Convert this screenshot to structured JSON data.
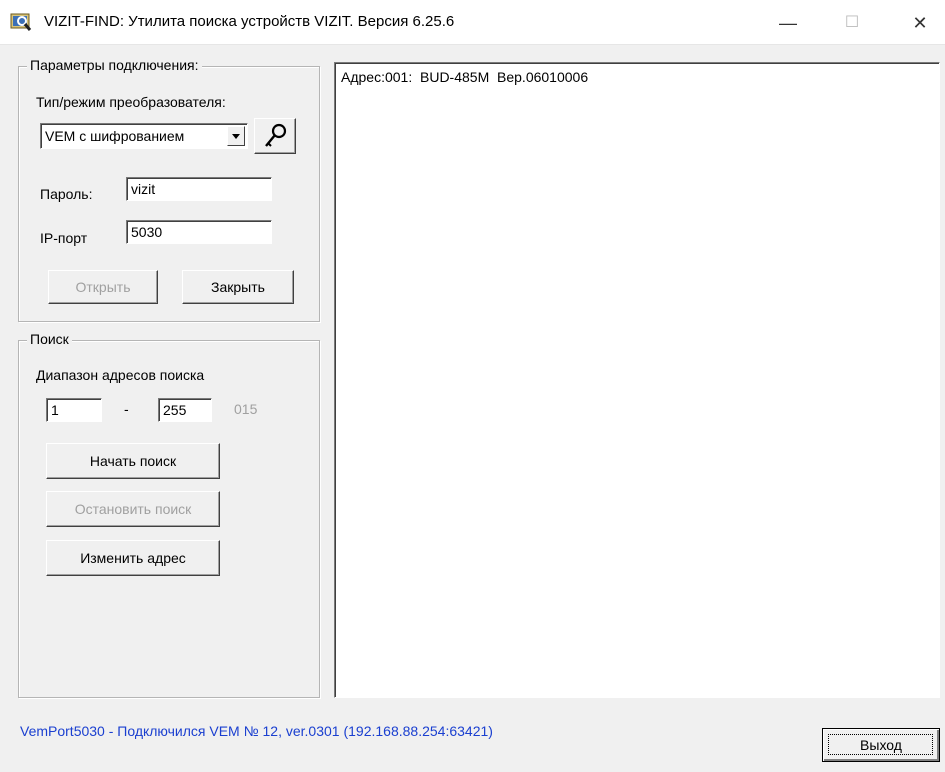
{
  "window": {
    "title": "VIZIT-FIND: Утилита поиска устройств VIZIT. Версия 6.25.6",
    "minimize": "—",
    "maximize": "☐",
    "close": "✕"
  },
  "connection": {
    "group_label": "Параметры подключения:",
    "converter_label": "Тип/режим преобразователя:",
    "converter_value": "VEM с шифрованием",
    "key_icon": "key-icon",
    "password_label": "Пароль:",
    "password_value": "vizit",
    "port_label": "IP-порт",
    "port_value": "5030",
    "open_label": "Открыть",
    "close_label": "Закрыть"
  },
  "search": {
    "group_label": "Поиск",
    "range_label": "Диапазон адресов поиска",
    "from_value": "1",
    "dash": "-",
    "to_value": "255",
    "current": "015",
    "start_label": "Начать поиск",
    "stop_label": "Остановить поиск",
    "change_label": "Изменить адрес"
  },
  "results": [
    "Адрес:001:  BUD-485M  Вер.06010006"
  ],
  "status_text": "VemPort5030  -  Подключился VEM № 12, ver.0301  (192.168.88.254:63421)",
  "exit_label": "Выход",
  "colors": {
    "status": "#1a3fd0",
    "disabled": "#a0a0a0",
    "face": "#f0f0f0"
  }
}
